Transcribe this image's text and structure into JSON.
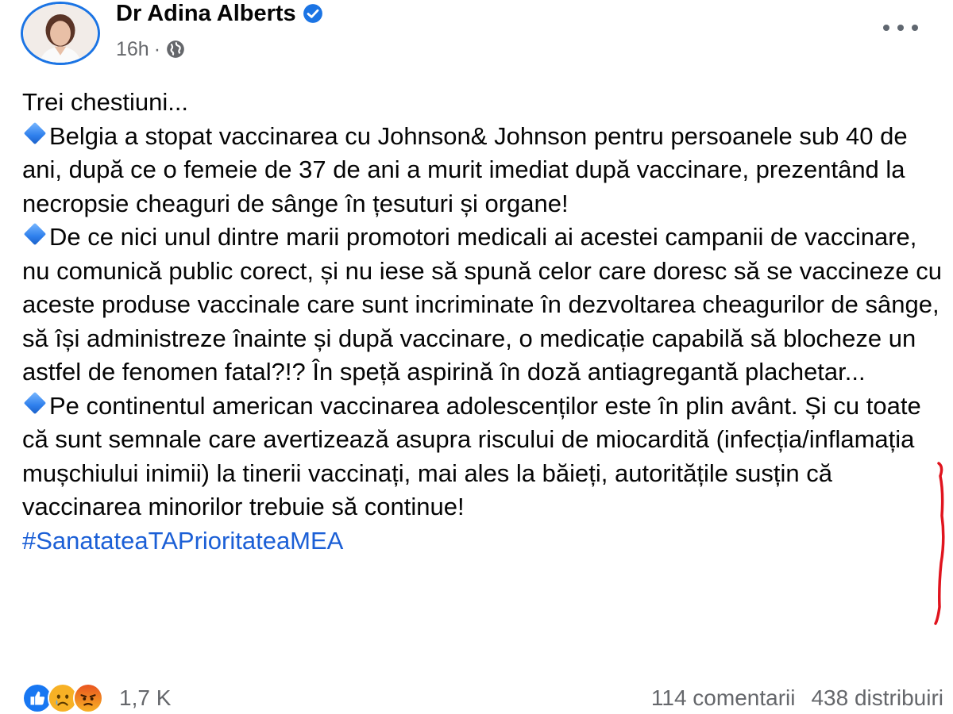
{
  "author": {
    "name": "Dr Adina Alberts",
    "verified_icon": "verified-badge-icon",
    "avatar_icon": "profile-photo"
  },
  "meta": {
    "time": "16h",
    "separator": "·",
    "audience_icon": "globe-icon"
  },
  "menu": {
    "icon": "more-options-icon"
  },
  "post": {
    "intro": "Trei chestiuni...",
    "points": [
      "Belgia a stopat vaccinarea cu Johnson& Johnson pentru persoanele sub 40 de ani, după ce o femeie de 37 de ani a murit imediat după vaccinare, prezentând la necropsie cheaguri de sânge în țesuturi și organe!",
      "De ce nici unul dintre marii promotori medicali ai acestei campanii de vaccinare, nu comunică public corect, și nu iese să spună celor care doresc să se vaccineze cu aceste produse vaccinale care sunt incriminate în dezvoltarea cheagurilor de sânge, să își administreze înainte și după vaccinare, o medicație capabilă să blocheze un astfel de fenomen fatal?!? În speță aspirină în doză antiagregantă plachetar...",
      "Pe continentul american vaccinarea adolescenților este în plin avânt. Și cu toate că sunt semnale care avertizează asupra riscului de miocardită (infecția/inflamația mușchiului inimii) la tinerii vaccinați, mai ales la băieți, autoritățile susțin că vaccinarea minorilor trebuie să continue!"
    ],
    "bullet_icon": "blue-diamond-icon",
    "hashtag": "#SanatateaTAPrioritateaMEA"
  },
  "annotation": {
    "color": "#e0141e",
    "icon": "red-hand-drawn-line"
  },
  "footer": {
    "reaction_icons": [
      "like-reaction-icon",
      "sad-reaction-icon",
      "angry-reaction-icon"
    ],
    "reaction_count": "1,7 K",
    "comments": "114 comentarii",
    "shares": "438 distribuiri"
  },
  "colors": {
    "accent": "#1b74e4",
    "hashtag": "#1b5fd6",
    "secondary_text": "#65676b"
  }
}
